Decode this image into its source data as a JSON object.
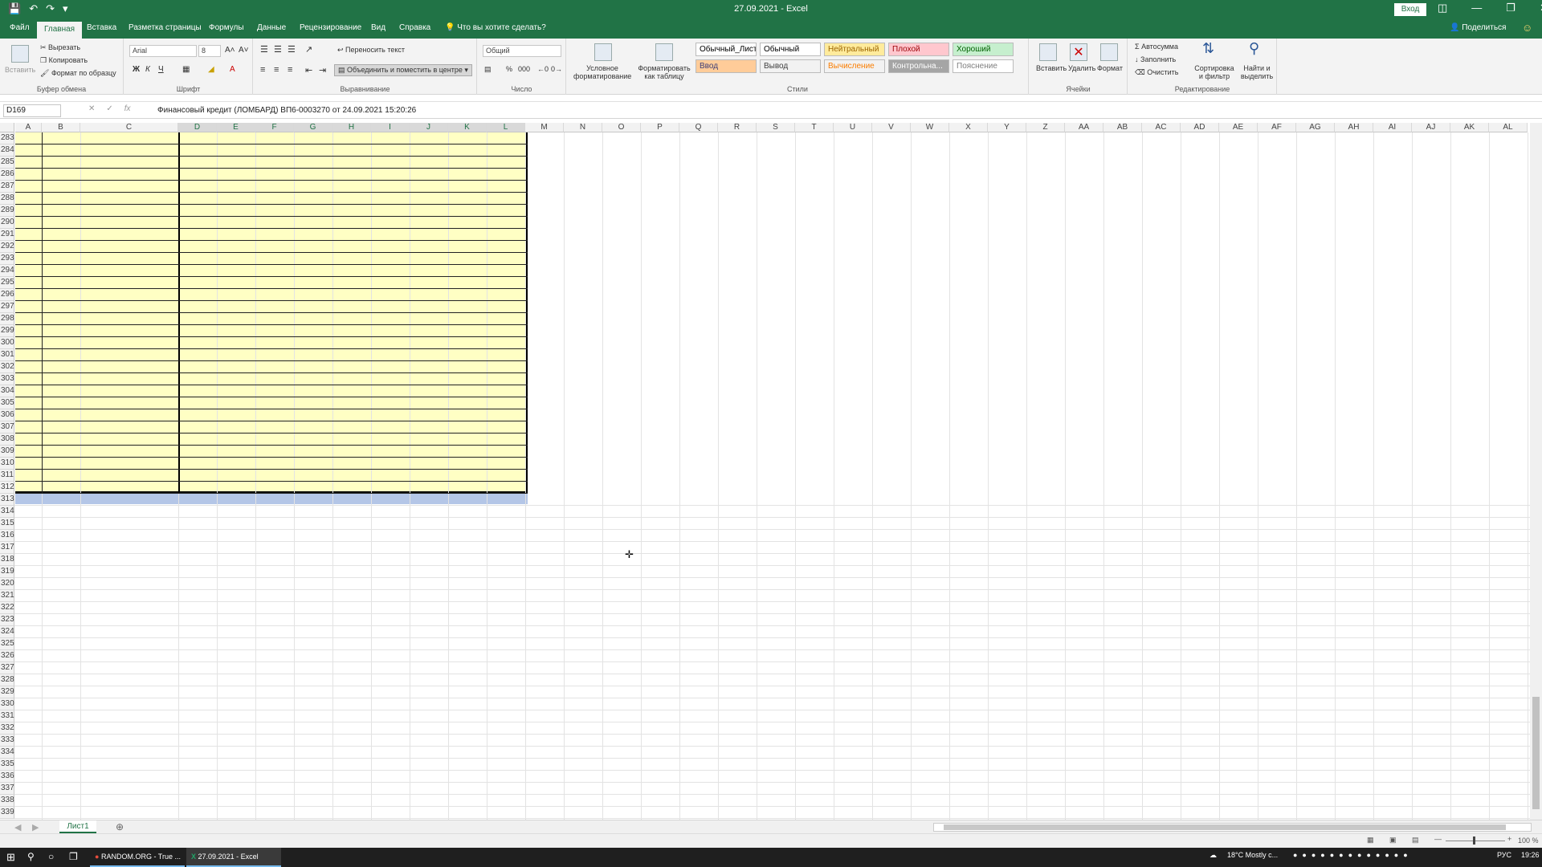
{
  "window": {
    "title": "27.09.2021 - Excel",
    "signin_label": "Вход"
  },
  "tabs": [
    "Файл",
    "Главная",
    "Вставка",
    "Разметка страницы",
    "Формулы",
    "Данные",
    "Рецензирование",
    "Вид",
    "Справка"
  ],
  "active_tab": "Главная",
  "tell_me": "Что вы хотите сделать?",
  "share_label": "Поделиться",
  "ribbon": {
    "clipboard": {
      "paste": "Вставить",
      "cut": "Вырезать",
      "copy": "Копировать",
      "format_painter": "Формат по образцу",
      "label": "Буфер обмена"
    },
    "font": {
      "name": "Arial",
      "size": "8",
      "bold": "Ж",
      "italic": "К",
      "underline": "Ч",
      "label": "Шрифт"
    },
    "alignment": {
      "wrap": "Переносить текст",
      "merge": "Объединить и поместить в центре",
      "label": "Выравнивание"
    },
    "number": {
      "format": "Общий",
      "label": "Число"
    },
    "styles": {
      "cond_format": "Условное форматирование",
      "format_table": "Форматировать как таблицу",
      "cells": [
        {
          "text": "Обычный_Лист1",
          "bg": "#ffffff",
          "fg": "#000000"
        },
        {
          "text": "Обычный",
          "bg": "#ffffff",
          "fg": "#000000"
        },
        {
          "text": "Нейтральный",
          "bg": "#ffeb9c",
          "fg": "#9c6500"
        },
        {
          "text": "Плохой",
          "bg": "#ffc7ce",
          "fg": "#9c0006"
        },
        {
          "text": "Хороший",
          "bg": "#c6efce",
          "fg": "#006100"
        },
        {
          "text": "Ввод",
          "bg": "#ffcc99",
          "fg": "#3f3f76"
        },
        {
          "text": "Вывод",
          "bg": "#f2f2f2",
          "fg": "#3f3f3f"
        },
        {
          "text": "Вычисление",
          "bg": "#f2f2f2",
          "fg": "#fa7d00"
        },
        {
          "text": "Контрольна...",
          "bg": "#a5a5a5",
          "fg": "#ffffff"
        },
        {
          "text": "Пояснение",
          "bg": "#ffffff",
          "fg": "#7f7f7f"
        }
      ],
      "label": "Стили"
    },
    "cells": {
      "insert": "Вставить",
      "delete": "Удалить",
      "format": "Формат",
      "label": "Ячейки"
    },
    "editing": {
      "autosum": "Автосумма",
      "fill": "Заполнить",
      "clear": "Очистить",
      "sort": "Сортировка и фильтр",
      "find": "Найти и выделить",
      "label": "Редактирование"
    }
  },
  "formula_bar": {
    "name_box": "D169",
    "fx": "fx",
    "formula": "Финансовый кредит (ЛОМБАРД) ВП6-0003270 от 24.09.2021 15:20:26"
  },
  "columns": [
    "A",
    "B",
    "C",
    "D",
    "E",
    "F",
    "G",
    "H",
    "I",
    "J",
    "K",
    "L",
    "M",
    "N",
    "O",
    "P",
    "Q",
    "R",
    "S",
    "T",
    "U",
    "V",
    "W",
    "X",
    "Y",
    "Z",
    "AA",
    "AB",
    "AC",
    "AD",
    "AE",
    "AF",
    "AG",
    "AH",
    "AI",
    "AJ",
    "AK",
    "AL"
  ],
  "rows": {
    "first": 283,
    "last": 339
  },
  "sheet": {
    "name": "Лист1"
  },
  "status": {
    "zoom": "100 %"
  },
  "taskbar": {
    "app1": "RANDOM.ORG - True ...",
    "app2": "27.09.2021 - Excel",
    "weather": "18°C  Mostly c...",
    "lang": "РУС",
    "time": "19:26"
  },
  "colors": {
    "accent": "#217346",
    "highlight": "#ffffc4",
    "band": "#b4c6e7"
  }
}
